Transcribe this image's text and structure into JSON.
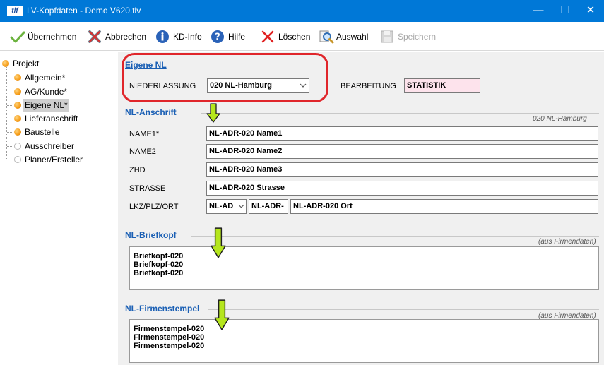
{
  "window": {
    "title": "LV-Kopfdaten - Demo V620.tlv",
    "app_icon_text": "tlf",
    "minimize": "—",
    "maximize": "☐",
    "close": "✕"
  },
  "toolbar": {
    "uebernehmen": "Übernehmen",
    "abbrechen": "Abbrechen",
    "kd_info": "KD-Info",
    "hilfe": "Hilfe",
    "loeschen": "Löschen",
    "auswahl": "Auswahl",
    "speichern": "Speichern"
  },
  "tree": {
    "root": "Projekt",
    "items": [
      {
        "label": "Allgemein*",
        "status": "orange"
      },
      {
        "label": "AG/Kunde*",
        "status": "orange"
      },
      {
        "label": "Eigene NL*",
        "status": "orange"
      },
      {
        "label": "Lieferanschrift",
        "status": "orange"
      },
      {
        "label": "Baustelle",
        "status": "orange"
      },
      {
        "label": "Ausschreiber",
        "status": "gray"
      },
      {
        "label": "Planer/Ersteller",
        "status": "gray"
      }
    ]
  },
  "eigene_nl": {
    "title": "Eigene NL",
    "niederlassung_label": "NIEDERLASSUNG",
    "niederlassung_value": "020 NL-Hamburg",
    "bearbeitung_label": "BEARBEITUNG",
    "bearbeitung_value": "STATISTIK"
  },
  "anschrift": {
    "title_pre": "NL-",
    "title_ul": "A",
    "title_post": "nschrift",
    "note": "020 NL-Hamburg",
    "name1_label": "NAME1*",
    "name1_value": "NL-ADR-020 Name1",
    "name2_label": "NAME2",
    "name2_value": "NL-ADR-020 Name2",
    "zhd_label": "ZHD",
    "zhd_value": "NL-ADR-020 Name3",
    "strasse_label": "STRASSE",
    "strasse_value": "NL-ADR-020 Strasse",
    "lkz_label": "LKZ/PLZ/ORT",
    "lkz_value": "NL-AD",
    "plz_value": "NL-ADR-",
    "ort_value": "NL-ADR-020 Ort"
  },
  "briefkopf": {
    "title": "NL-Briefkopf",
    "note": "(aus Firmendaten)",
    "lines": [
      "Briefkopf-020",
      "Briefkopf-020",
      "Briefkopf-020"
    ]
  },
  "firmenstempel": {
    "title": "NL-Firmenstempel",
    "note": "(aus Firmendaten)",
    "lines": [
      "Firmenstempel-020",
      "Firmenstempel-020",
      "Firmenstempel-020"
    ]
  },
  "colors": {
    "titlebar": "#0078d7",
    "section_title": "#1a5fb4",
    "highlight": "#e0262b",
    "arrow_fill": "#b5e61d",
    "bearbeitung_bg": "#fde3ec"
  }
}
